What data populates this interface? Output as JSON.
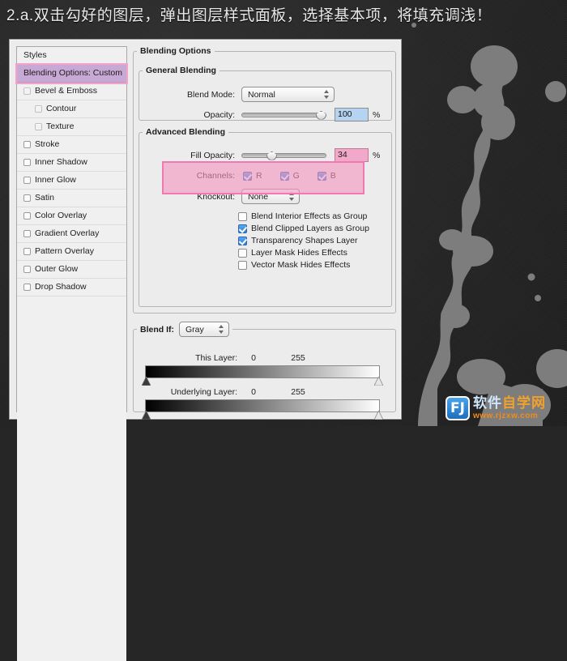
{
  "caption": "2.a.双击勾好的图层，弹出图层样式面板，选择基本项，将填充调浅！",
  "dialog": {
    "styles_panel": {
      "header": "Styles",
      "selected": "Blending Options: Custom",
      "items": [
        {
          "label": "Bevel & Emboss",
          "checked": false,
          "indent": 0,
          "dim": true
        },
        {
          "label": "Contour",
          "checked": false,
          "indent": 1,
          "dim": true
        },
        {
          "label": "Texture",
          "checked": false,
          "indent": 1,
          "dim": true
        },
        {
          "label": "Stroke",
          "checked": false,
          "indent": 0,
          "dim": false
        },
        {
          "label": "Inner Shadow",
          "checked": false,
          "indent": 0,
          "dim": false
        },
        {
          "label": "Inner Glow",
          "checked": false,
          "indent": 0,
          "dim": false
        },
        {
          "label": "Satin",
          "checked": false,
          "indent": 0,
          "dim": false
        },
        {
          "label": "Color Overlay",
          "checked": false,
          "indent": 0,
          "dim": false
        },
        {
          "label": "Gradient Overlay",
          "checked": false,
          "indent": 0,
          "dim": false
        },
        {
          "label": "Pattern Overlay",
          "checked": false,
          "indent": 0,
          "dim": false
        },
        {
          "label": "Outer Glow",
          "checked": false,
          "indent": 0,
          "dim": false
        },
        {
          "label": "Drop Shadow",
          "checked": false,
          "indent": 0,
          "dim": false
        }
      ]
    },
    "blending_options": {
      "group_title": "Blending Options",
      "general": {
        "title": "General Blending",
        "blend_mode_label": "Blend Mode:",
        "blend_mode_value": "Normal",
        "opacity_label": "Opacity:",
        "opacity_value": "100",
        "opacity_unit": "%"
      },
      "advanced": {
        "title": "Advanced Blending",
        "fill_opacity_label": "Fill Opacity:",
        "fill_opacity_value": "34",
        "fill_opacity_unit": "%",
        "channels_label": "Channels:",
        "channels": [
          {
            "label": "R",
            "checked": true
          },
          {
            "label": "G",
            "checked": true
          },
          {
            "label": "B",
            "checked": true
          }
        ],
        "knockout_label": "Knockout:",
        "knockout_value": "None",
        "checkboxes": [
          {
            "label": "Blend Interior Effects as Group",
            "checked": false
          },
          {
            "label": "Blend Clipped Layers as Group",
            "checked": true
          },
          {
            "label": "Transparency Shapes Layer",
            "checked": true
          },
          {
            "label": "Layer Mask Hides Effects",
            "checked": false
          },
          {
            "label": "Vector Mask Hides Effects",
            "checked": false
          }
        ]
      },
      "blend_if": {
        "label": "Blend If:",
        "value": "Gray",
        "this_layer": {
          "label": "This Layer:",
          "min": "0",
          "max": "255"
        },
        "underlying_layer": {
          "label": "Underlying Layer:",
          "min": "0",
          "max": "255"
        }
      }
    }
  },
  "canvas": {
    "letter": "a",
    "letter_color": "#f4a3a3",
    "ink_color": "#7d7d7d",
    "background_color": "#262626"
  },
  "watermark": {
    "badge": "FJ",
    "name_blue": "软件",
    "name_orange": "自学网",
    "url": "www.rjzxw.com"
  }
}
